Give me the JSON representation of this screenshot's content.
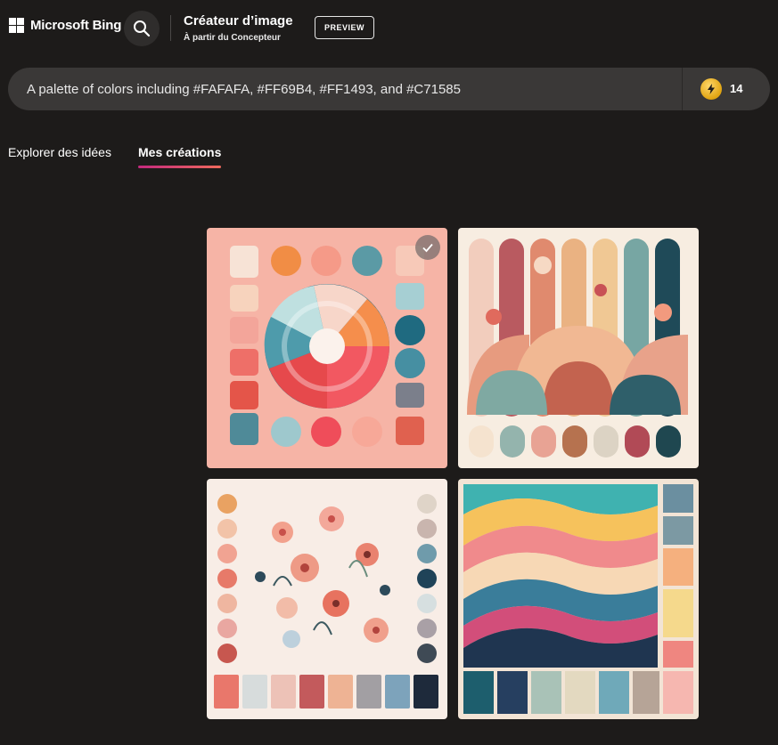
{
  "header": {
    "brand": "Microsoft Bing",
    "title": "Créateur d’image",
    "subtitle": "À partir du Concepteur",
    "badge": "PREVIEW"
  },
  "prompt": {
    "text": "A palette of colors including #FAFAFA, #FF69B4, #FF1493, and #C71585",
    "boosts": "14"
  },
  "tabs": [
    {
      "label": "Explorer des idées",
      "active": false
    },
    {
      "label": "Mes créations",
      "active": true
    }
  ],
  "colors": {
    "background": "#1d1b1a",
    "prompt_bg": "#3a3837",
    "tab_accent_start": "#c4297e",
    "tab_accent_end": "#f06a5c"
  },
  "images": [
    {
      "name": "palette-wheel-image",
      "selected": true
    },
    {
      "name": "floral-arches-image",
      "selected": false
    },
    {
      "name": "floral-swatches-image",
      "selected": false
    },
    {
      "name": "waves-palette-image",
      "selected": false
    }
  ]
}
